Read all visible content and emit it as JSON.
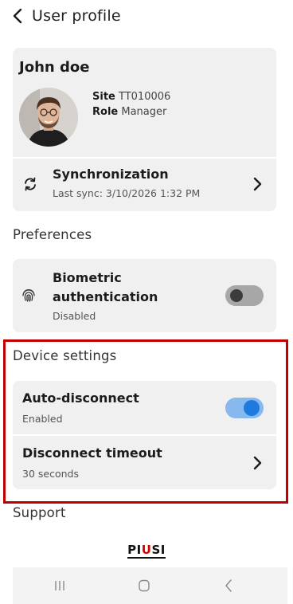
{
  "header": {
    "title": "User profile"
  },
  "profile": {
    "name": "John doe",
    "site_label": "Site",
    "site_value": "TT010006",
    "role_label": "Role",
    "role_value": "Manager"
  },
  "sync": {
    "title": "Synchronization",
    "subtitle": "Last sync: 3/10/2026 1:32 PM"
  },
  "preferences": {
    "section_title": "Preferences",
    "biometric": {
      "title": "Biometric authentication",
      "status": "Disabled",
      "enabled": false
    }
  },
  "device_settings": {
    "section_title": "Device settings",
    "auto_disconnect": {
      "title": "Auto-disconnect",
      "status": "Enabled",
      "enabled": true
    },
    "disconnect_timeout": {
      "title": "Disconnect timeout",
      "value": "30 seconds"
    }
  },
  "support": {
    "section_title": "Support"
  },
  "brand": {
    "logo_text_a": "PI",
    "logo_text_b": "U",
    "logo_text_c": "SI"
  },
  "colors": {
    "accent": "#1f7ae0",
    "highlight_border": "#c00000",
    "card_bg": "#f0f0f0"
  },
  "icons": {
    "back": "chevron-left-icon",
    "sync": "sync-icon",
    "chevron": "chevron-right-icon",
    "fingerprint": "fingerprint-icon",
    "nav_recents": "recents-icon",
    "nav_home": "home-icon",
    "nav_back": "back-icon"
  }
}
